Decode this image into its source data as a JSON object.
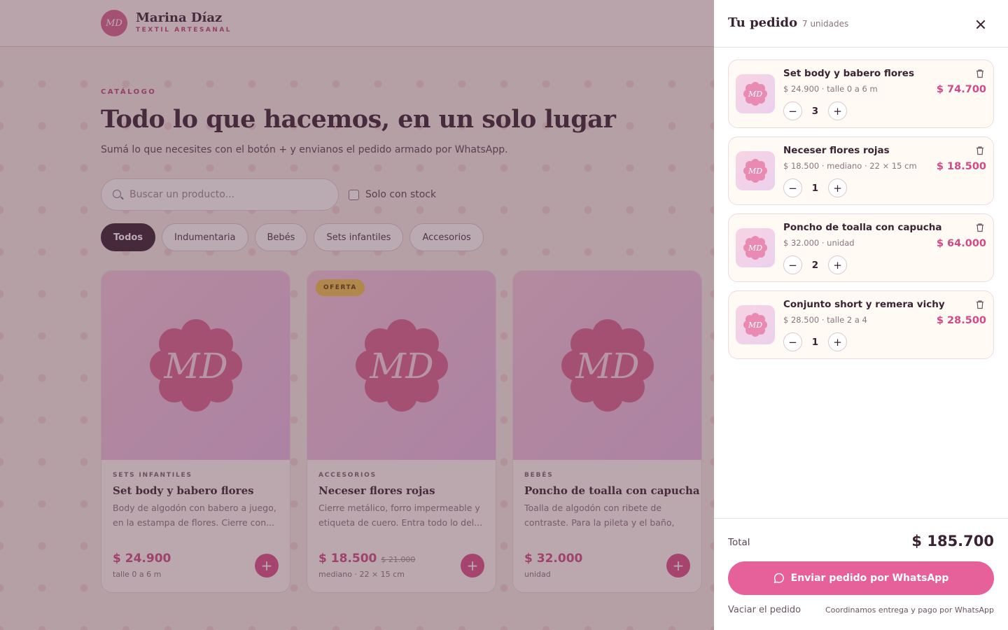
{
  "brand": {
    "monogram": "MD",
    "name": "Marina Díaz",
    "tagline": "TEXTIL ARTESANAL"
  },
  "catalog": {
    "eyebrow": "CATÁLOGO",
    "title": "Todo lo que hacemos, en un solo lugar",
    "subtitle": "Sumá lo que necesites con el botón + y envianos el pedido armado por WhatsApp.",
    "search_placeholder": "Buscar un producto...",
    "stock_filter_label": "Solo con stock",
    "stock_filter_checked": false,
    "categories": [
      "Todos",
      "Indumentaria",
      "Bebés",
      "Sets infantiles",
      "Accesorios"
    ],
    "active_category": "Todos"
  },
  "products": [
    {
      "badge": "",
      "category": "SETS INFANTILES",
      "name": "Set body y babero flores",
      "description": "Body de algodón con babero a juego, en la estampa de flores. Cierre con...",
      "price": "$ 24.900",
      "old_price": "",
      "unit": "talle 0 a 6 m"
    },
    {
      "badge": "OFERTA",
      "category": "ACCESORIOS",
      "name": "Neceser flores rojas",
      "description": "Cierre metálico, forro impermeable y etiqueta de cuero. Entra todo lo del...",
      "price": "$ 18.500",
      "old_price": "$ 21.000",
      "unit": "mediano · 22 × 15 cm"
    },
    {
      "badge": "",
      "category": "BEBÉS",
      "name": "Poncho de toalla con capucha",
      "description": "Toalla de algodón con ribete de contraste. Para la pileta y el baño, de...",
      "price": "$ 32.000",
      "old_price": "",
      "unit": "unidad"
    }
  ],
  "cart": {
    "title": "Tu pedido",
    "count_label": "7 unidades",
    "items": [
      {
        "name": "Set body y babero flores",
        "meta": "$ 24.900 · talle 0 a 6 m",
        "qty": "3",
        "total": "$ 74.700"
      },
      {
        "name": "Neceser flores rojas",
        "meta": "$ 18.500 · mediano · 22 × 15 cm",
        "qty": "1",
        "total": "$ 18.500"
      },
      {
        "name": "Poncho de toalla con capucha",
        "meta": "$ 32.000 · unidad",
        "qty": "2",
        "total": "$ 64.000"
      },
      {
        "name": "Conjunto short y remera vichy",
        "meta": "$ 28.500 · talle 2 a 4",
        "qty": "1",
        "total": "$ 28.500"
      }
    ],
    "total_label": "Total",
    "total_value": "$ 185.700",
    "send_button": "Enviar pedido por WhatsApp",
    "empty_link": "Vaciar el pedido",
    "footer_note": "Coordinamos entrega y pago por WhatsApp"
  },
  "colors": {
    "accent": "#d94f8a",
    "dark": "#3a1f33",
    "offer": "#f2c14e"
  },
  "icons": [
    "search-icon",
    "close-icon",
    "trash-icon",
    "minus-icon",
    "plus-icon",
    "whatsapp-icon",
    "flower-logo-icon"
  ]
}
